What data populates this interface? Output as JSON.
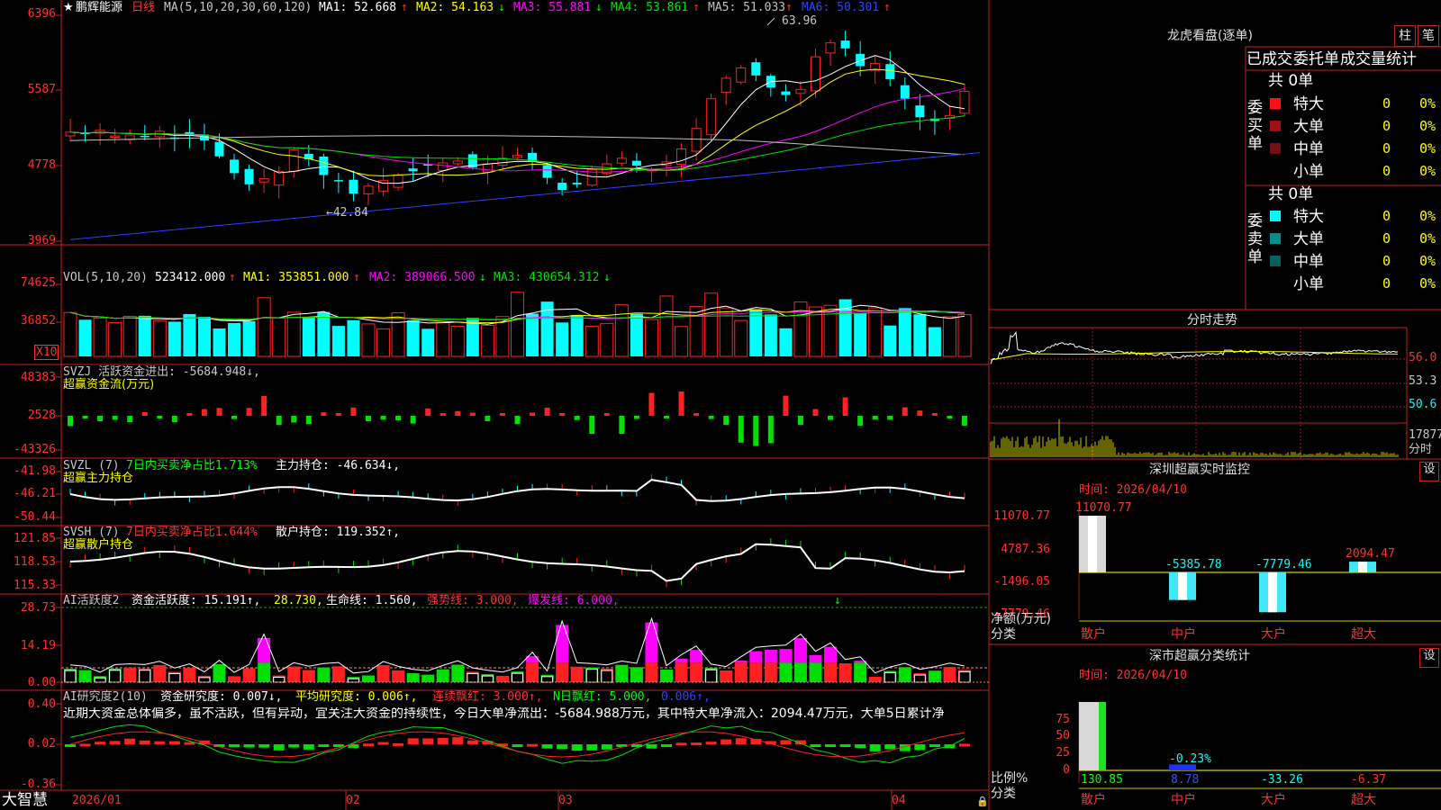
{
  "colors": {
    "up": "#ff2020",
    "down": "#00ffff",
    "panel_border": "#c81e1e",
    "white": "#ffffff",
    "yellow": "#ffff00",
    "magenta": "#ff00ff",
    "green": "#00e000",
    "blue": "#2030ff",
    "gray": "#c0c0c0",
    "bg": "#000000",
    "zero": "#ffff00",
    "ma6": "#3040ff"
  },
  "main": {
    "star": "★",
    "stock_name": "鹏辉能源",
    "period": "日线",
    "ma_spec": "MA(5,10,20,30,60,120)",
    "ma1": "MA1: 52.668",
    "ma1_arrow": "↑",
    "ma2": "MA2: 54.163",
    "ma2_arrow": "↓",
    "ma3": "MA3: 55.881",
    "ma3_arrow": "↓",
    "ma4": "MA4: 53.861",
    "ma4_arrow": "↑",
    "ma5": "MA5: 51.033",
    "ma5_arrow": "↑",
    "ma6": "MA6: 50.301",
    "ma6_arrow": "↑",
    "yticks": [
      "6396",
      "5587",
      "4778",
      "3969"
    ],
    "high_mark": "63.96",
    "low_mark": "←42.84"
  },
  "vol": {
    "title": "VOL(5,10,20)",
    "val": "523412.000",
    "val_arrow": "↑",
    "ma1": "MA1: 353851.000",
    "ma1_arrow": "↑",
    "ma2": "MA2: 389066.500",
    "ma2_arrow": "↓",
    "ma3": "MA3: 430654.312",
    "ma3_arrow": "↓",
    "yticks": [
      "74625",
      "36852"
    ],
    "unit": "X10"
  },
  "svzj": {
    "title": "SVZJ  活跃资金进出: -5684.948↓,",
    "sub": "超赢资金流(万元)",
    "yticks": [
      "48383",
      "2528",
      "-43326"
    ]
  },
  "svzl": {
    "title": "SVZL (7)",
    "part2": "7日内买卖净占比1.713%",
    "part3": "主力持仓: -46.634↓,",
    "sub": "超赢主力持仓",
    "yticks": [
      "-41.98",
      "-46.21",
      "-50.44"
    ]
  },
  "svsh": {
    "title": "SVSH (7)",
    "part2": "7日内买卖净占比1.644%",
    "part3": "散户持仓: 119.352↑,",
    "sub": "超赢散户持仓",
    "yticks": [
      "121.85",
      "118.53",
      "115.33"
    ]
  },
  "ai1": {
    "title": "AI活跃度2",
    "part1": "资金活跃度: 15.191↑,",
    "part2": "28.730,",
    "part3": "生命线: 1.560,",
    "part4": "强势线: 3.000,",
    "part5": "爆发线: 6.000,",
    "yticks": [
      "28.73",
      "14.19",
      "0.00"
    ],
    "signal": "↓"
  },
  "ai2": {
    "title": "AI研究度2(10)",
    "part1": "资金研究度: 0.007↓,",
    "part2": "平均研究度: 0.006↑,",
    "part3": "连续飘红: 3.000↑,",
    "part4": "N日飘红: 5.000,",
    "part5": "0.006↑,",
    "text": "近期大资金总体偏多，虽不活跃，但有异动，宜关注大资金的持续性，今日大单净流出：-5684.988万元，其中特大单净流入：2094.47万元，大单5日累计净",
    "yticks": [
      "0.40",
      "0.02",
      "-0.36"
    ]
  },
  "xaxis": {
    "labels": [
      "2026/01",
      "02",
      "03",
      "04"
    ]
  },
  "brand": "大智慧",
  "right": {
    "dragon_title": "龙虎看盘(逐单)",
    "btn_bar": "柱",
    "btn_pen": "笔",
    "header_cols": [
      "已成交",
      "委托单",
      "成交量统计"
    ],
    "buy_label": "委买单",
    "sell_label": "委卖单",
    "buy_total": "共 0单",
    "sell_total": "共 0单",
    "buy_rows": [
      {
        "name": "特大",
        "val": "0",
        "pct": "0%",
        "color": "#ff1010"
      },
      {
        "name": "大单",
        "val": "0",
        "pct": "0%",
        "color": "#a01010"
      },
      {
        "name": "中单",
        "val": "0",
        "pct": "0%",
        "color": "#701010"
      },
      {
        "name": "小单",
        "val": "0",
        "pct": "0%",
        "color": "#000000"
      }
    ],
    "sell_rows": [
      {
        "name": "特大",
        "val": "0",
        "pct": "0%",
        "color": "#00ffff"
      },
      {
        "name": "大单",
        "val": "0",
        "pct": "0%",
        "color": "#008c8c"
      },
      {
        "name": "中单",
        "val": "0",
        "pct": "0%",
        "color": "#006060"
      },
      {
        "name": "小单",
        "val": "0",
        "pct": "0%",
        "color": "#000000"
      }
    ],
    "fenshi_title": "分时走势",
    "fenshi_yticks": [
      "56.0",
      "53.3",
      "50.6"
    ],
    "fenshi_vol": "17877",
    "fenshi_unit": "分时",
    "sz_title": "深圳超赢实时监控",
    "sz_btn": "设",
    "sz_time": "时间: 2026/04/10",
    "sz_yticks": [
      "11070.77",
      "4787.36",
      "-1496.05",
      "-7779.46"
    ],
    "sz_ylabel": "净额(万元)",
    "sz_xlabel": "分类",
    "sz_cats": [
      "散户",
      "中户",
      "大户",
      "超大"
    ],
    "sz_values": [
      11070.77,
      -5385.78,
      -7779.46,
      2094.47
    ],
    "sz_value_labels": [
      "11070.77",
      "-5385.78",
      "-7779.46",
      "2094.47"
    ],
    "ss_title": "深市超赢分类统计",
    "ss_btn": "设",
    "ss_time": "时间: 2026/04/10",
    "ss_yticks": [
      "75",
      "50",
      "25",
      "0"
    ],
    "ss_ylabel": "比例%",
    "ss_xlabel": "分类",
    "ss_cats": [
      "散户",
      "中户",
      "大户",
      "超大"
    ],
    "ss_values": [
      130.85,
      8.78,
      -33.26,
      -6.37
    ],
    "ss_value_labels": [
      "130.85",
      "8.78",
      "-33.26",
      "-6.37"
    ],
    "ss_note": "-0.23%"
  }
}
